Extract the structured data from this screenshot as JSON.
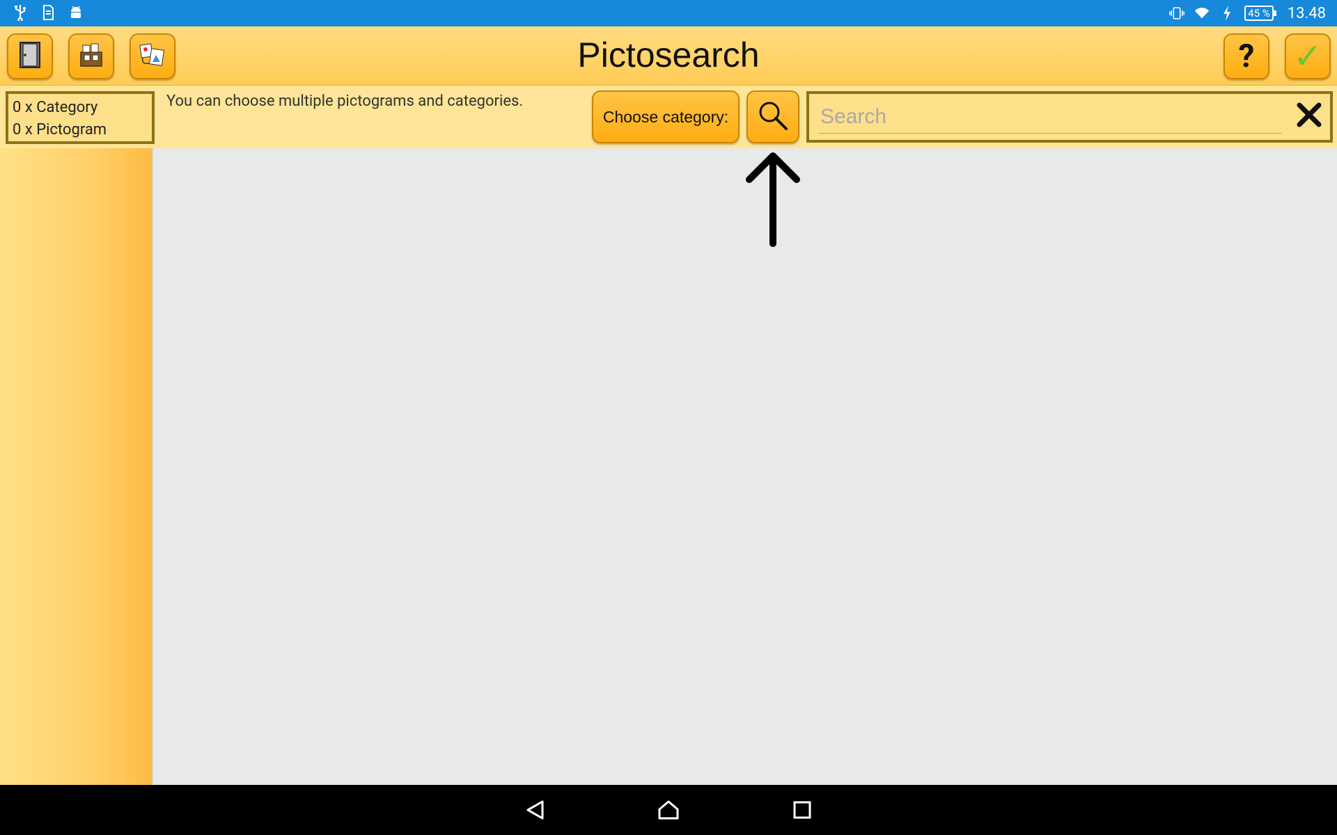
{
  "status_bar": {
    "battery": "45 %",
    "time": "13.48",
    "left_icons": [
      "usb-icon",
      "sd-card-icon",
      "android-icon"
    ],
    "right_icons": [
      "vibrate-icon",
      "wifi-icon",
      "charging-icon",
      "battery-icon"
    ]
  },
  "header": {
    "title": "Pictosearch",
    "buttons": {
      "exit": "door-icon",
      "category_tool": "category-tool-icon",
      "pictogram_tool": "pictogram-tool-icon",
      "help": "?",
      "accept": "✓"
    },
    "colors": {
      "accent": "#ffad12",
      "check": "#6ec52f",
      "status_bar": "#1689db"
    }
  },
  "toolbar": {
    "category_count": "0 x Category",
    "pictogram_count": "0 x Pictogram",
    "hint": "You can choose multiple pictograms and categories.",
    "choose_category": "Choose category:",
    "search_placeholder": "Search",
    "search_value": ""
  },
  "nav_bar": {
    "icons": [
      "back-icon",
      "home-icon",
      "recents-icon"
    ]
  }
}
